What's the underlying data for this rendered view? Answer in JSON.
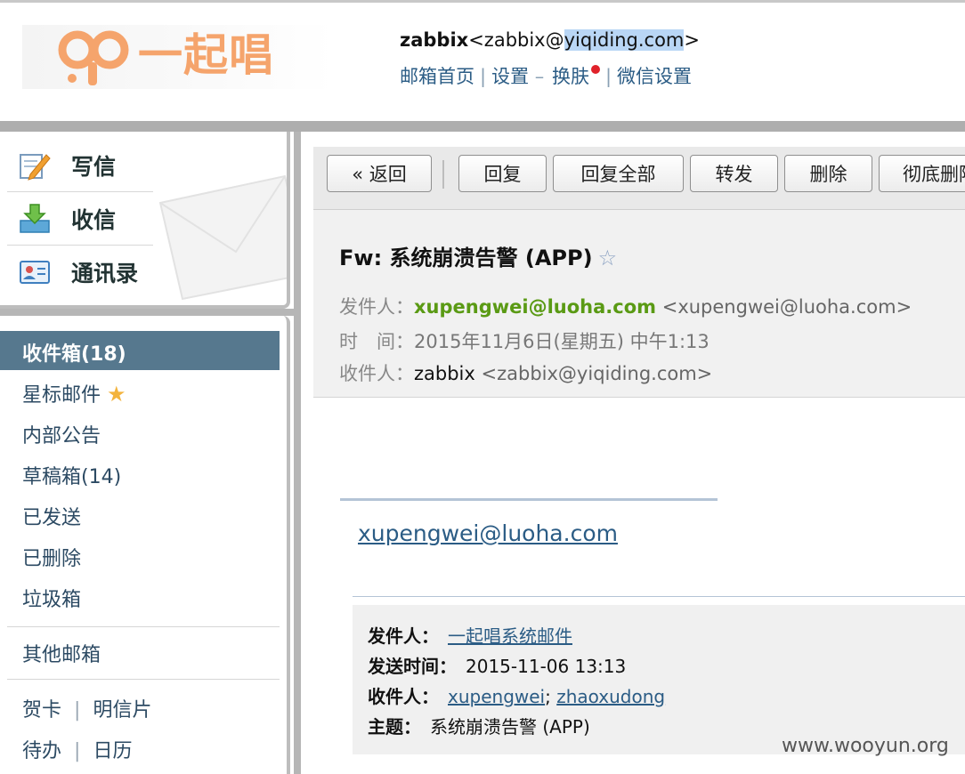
{
  "logo": {
    "text": "一起唱"
  },
  "header": {
    "user_name": "zabbix",
    "user_email_prefix": "<zabbix@",
    "user_email_domain": "yiqiding.com",
    "user_email_suffix": ">",
    "links": {
      "home": "邮箱首页",
      "settings": "设置",
      "dash": "–",
      "skin": "换肤",
      "wechat": "微信设置"
    },
    "separator": "|"
  },
  "quick_actions": {
    "compose": "写信",
    "receive": "收信",
    "contacts": "通讯录"
  },
  "folders": {
    "inbox": "收件箱(18)",
    "starred": "星标邮件",
    "starred_icon": "★",
    "internal": "内部公告",
    "drafts": "草稿箱(14)",
    "sent": "已发送",
    "deleted": "已删除",
    "spam": "垃圾箱",
    "other": "其他邮箱",
    "card": "贺卡",
    "postcard": "明信片",
    "todo": "待办",
    "calendar": "日历",
    "separator": "|"
  },
  "toolbar": {
    "back": "« 返回",
    "reply": "回复",
    "reply_all": "回复全部",
    "forward": "转发",
    "delete": "删除",
    "purge": "彻底删除"
  },
  "message": {
    "subject": "Fw: 系统崩溃告警 (APP)",
    "star_icon": "☆",
    "from_label": "发件人：",
    "from_name": "xupengwei@luoha.com",
    "from_addr": "<xupengwei@luoha.com>",
    "time_label": "时　间：",
    "time_value": "2015年11月6日(星期五) 中午1:13",
    "to_label": "收件人：",
    "to_name": "zabbix",
    "to_addr": "<zabbix@yiqiding.com>"
  },
  "body": {
    "link": "xupengwei@luoha.com",
    "fwd_from_label": "发件人：",
    "fwd_from": "一起唱系统邮件",
    "fwd_time_label": "发送时间：",
    "fwd_time": "2015-11-06 13:13",
    "fwd_to_label": "收件人：",
    "fwd_to_1": "xupengwei",
    "fwd_to_sep": ";",
    "fwd_to_2": "zhaoxudong",
    "fwd_subject_label": "主题：",
    "fwd_subject": "系统崩溃告警 (APP)"
  },
  "watermark": "www.wooyun.org"
}
